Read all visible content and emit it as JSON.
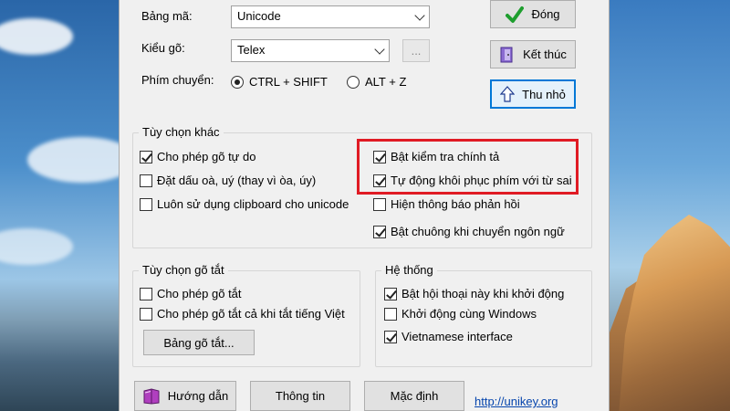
{
  "settings": {
    "charset_label": "Bảng mã:",
    "charset_value": "Unicode",
    "input_method_label": "Kiểu gõ:",
    "input_method_value": "Telex",
    "input_method_more": "...",
    "switch_key_label": "Phím chuyển:",
    "switch_options": [
      {
        "label": "CTRL + SHIFT",
        "selected": true
      },
      {
        "label": "ALT + Z",
        "selected": false
      }
    ]
  },
  "buttons": {
    "close": "Đóng",
    "exit": "Kết thúc",
    "minimize": "Thu nhỏ"
  },
  "other_options": {
    "title": "Tùy chọn khác",
    "left": [
      {
        "label": "Cho phép gõ tự do",
        "checked": true
      },
      {
        "label": "Đặt dấu oà, uý (thay vì òa, úy)",
        "checked": false
      },
      {
        "label": "Luôn sử dụng clipboard cho unicode",
        "checked": false
      }
    ],
    "right": [
      {
        "label": "Bật kiểm tra chính tả",
        "checked": true
      },
      {
        "label": "Tự động khôi phục phím với từ sai",
        "checked": true
      },
      {
        "label": "Hiện thông báo phản hồi",
        "checked": false
      },
      {
        "label": "Bật chuông khi chuyển ngôn ngữ",
        "checked": true
      }
    ]
  },
  "shorthand": {
    "title": "Tùy chọn gõ tắt",
    "items": [
      {
        "label": "Cho phép gõ tắt",
        "checked": false
      },
      {
        "label": "Cho phép gõ tắt cả khi tắt tiếng Việt",
        "checked": false
      }
    ],
    "table_button": "Bảng gõ tắt..."
  },
  "system": {
    "title": "Hệ thống",
    "items": [
      {
        "label": "Bật hội thoại này khi khởi động",
        "checked": true
      },
      {
        "label": "Khởi động cùng Windows",
        "checked": false
      },
      {
        "label": "Vietnamese interface",
        "checked": true
      }
    ]
  },
  "footer": {
    "help": "Hướng dẫn",
    "info": "Thông tin",
    "default": "Mặc định",
    "link": "http://unikey.org"
  },
  "colors": {
    "highlight": "#e01b24",
    "check_green": "#1e9e2e",
    "link": "#0645ad"
  }
}
